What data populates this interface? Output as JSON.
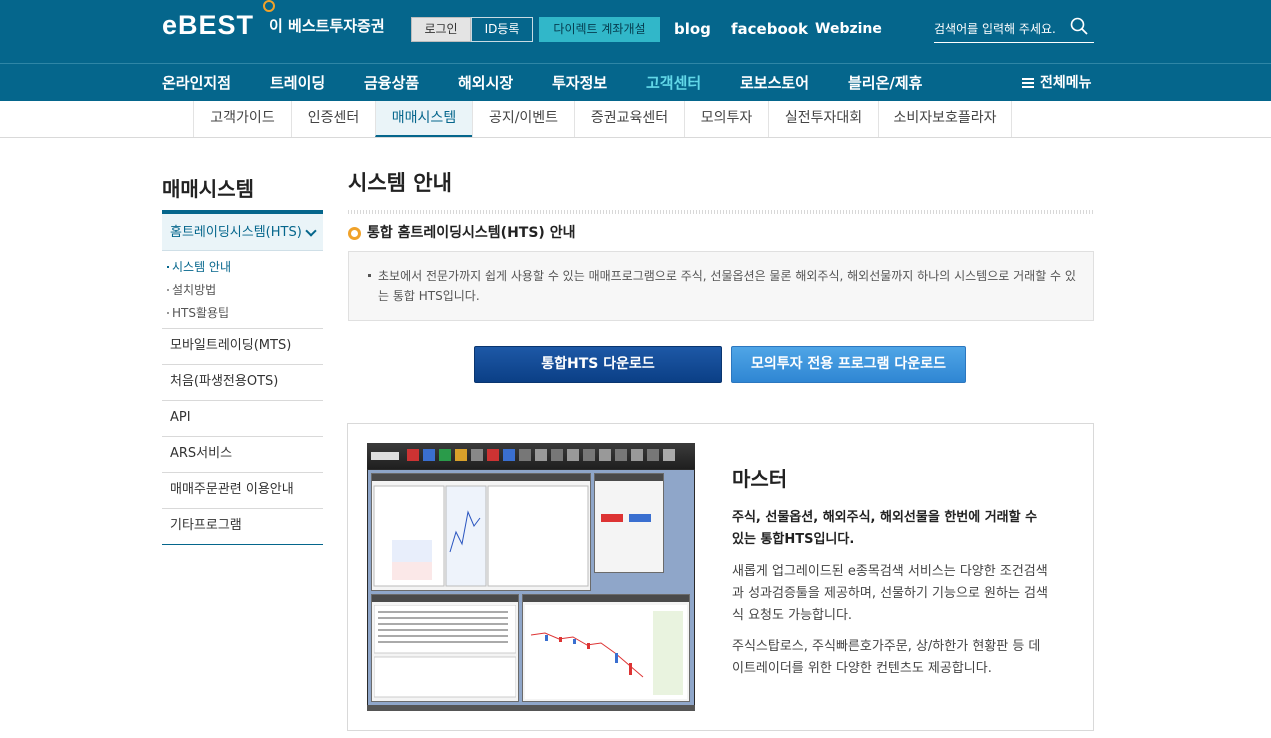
{
  "brand": {
    "logo_mark": "eBEST",
    "name": "이 베스트투자증권"
  },
  "header": {
    "login": "로그인",
    "id_register": "ID등록",
    "direct_account": "다이렉트 계좌개설",
    "links": {
      "blog": "blog",
      "facebook": "facebook",
      "webzine": "Webzine"
    },
    "search_placeholder": "검색어를 입력해 주세요."
  },
  "main_nav": {
    "items": [
      "온라인지점",
      "트레이딩",
      "금융상품",
      "해외시장",
      "투자정보",
      "고객센터",
      "로보스토어",
      "블리온/제휴"
    ],
    "active": "고객센터",
    "all_menu": "전체메뉴"
  },
  "sub_nav": {
    "items": [
      "고객가이드",
      "인증센터",
      "매매시스템",
      "공지/이벤트",
      "증권교육센터",
      "모의투자",
      "실전투자대회",
      "소비자보호플라자"
    ],
    "active": "매매시스템"
  },
  "sidebar": {
    "title": "매매시스템",
    "active_item": "홈트레이딩시스템(HTS)",
    "sub_items": [
      "시스템 안내",
      "설치방법",
      "HTS활용팁"
    ],
    "items": [
      "모바일트레이딩(MTS)",
      "처음(파생전용OTS)",
      "API",
      "ARS서비스",
      "매매주문관련 이용안내",
      "기타프로그램"
    ]
  },
  "content": {
    "page_title": "시스템 안내",
    "section_title": "통합 홈트레이딩시스템(HTS) 안내",
    "notice": "초보에서 전문가까지 쉽게 사용할 수 있는 매매프로그램으로 주식, 선물옵션은 물론 해외주식, 해외선물까지 하나의 시스템으로 거래할 수 있는 통합 HTS입니다.",
    "buttons": {
      "download_hts": "통합HTS 다운로드",
      "download_mock": "모의투자 전용 프로그램 다운로드"
    },
    "product": {
      "title": "마스터",
      "lead": "주식, 선물옵션, 해외주식, 해외선물을 한번에 거래할 수 있는 통합HTS입니다.",
      "desc1": "새롭게 업그레이드된 e종목검색 서비스는 다양한 조건검색과 성과검증툴을 제공하며, 선물하기 기능으로 원하는 검색식 요청도 가능합니다.",
      "desc2": "주식스탑로스, 주식빠른호가주문, 상/하한가 현황판 등 데이트레이더를 위한 다양한 컨텐츠도 제공합니다.",
      "screenshot_caption": "",
      "screenshot_icon": "hts-screenshot"
    }
  },
  "colors": {
    "brand": "#05668c",
    "accent": "#f0a22a",
    "cyan": "#31b7c9",
    "active_nav": "#62d8e8",
    "button_dark": "#0b3f86",
    "button_light": "#2f86d3"
  }
}
